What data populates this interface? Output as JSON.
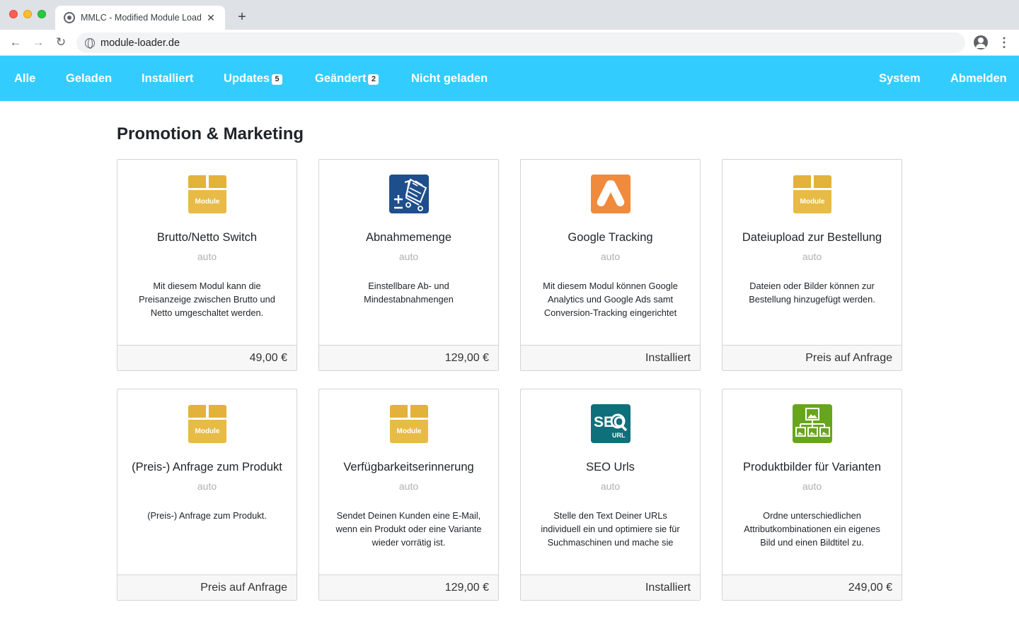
{
  "browser": {
    "tab_title": "MMLC - Modified Module Loader Client",
    "tab_close": "✕",
    "new_tab": "+",
    "url": "module-loader.de"
  },
  "nav": {
    "items": [
      {
        "label": "Alle"
      },
      {
        "label": "Geladen"
      },
      {
        "label": "Installiert"
      },
      {
        "label": "Updates",
        "badge": "5"
      },
      {
        "label": "Geändert",
        "badge": "2"
      },
      {
        "label": "Nicht geladen"
      }
    ],
    "right": [
      {
        "label": "System"
      },
      {
        "label": "Abmelden"
      }
    ],
    "color": "#33ccff"
  },
  "section": {
    "title": "Promotion & Marketing"
  },
  "modules": [
    {
      "icon": "module-box-icon",
      "icon_label": "Module",
      "title": "Brutto/Netto Switch",
      "sub": "auto",
      "desc": "Mit diesem Modul kann die Preisanzeige zwischen Brutto und Netto umgeschaltet werden.",
      "price": "49,00 €"
    },
    {
      "icon": "cart-quantity-icon",
      "title": "Abnahmemenge",
      "sub": "auto",
      "desc": "Einstellbare Ab- und Mindestabnahmengen",
      "price": "129,00 €"
    },
    {
      "icon": "google-ads-icon",
      "title": "Google Tracking",
      "sub": "auto",
      "desc": "Mit diesem Modul können Google Analytics und Google Ads samt Conversion-Tracking eingerichtet",
      "price": "Installiert"
    },
    {
      "icon": "module-box-icon",
      "icon_label": "Module",
      "title": "Dateiupload zur Bestellung",
      "sub": "auto",
      "desc": "Dateien oder Bilder können zur Bestellung hinzugefügt werden.",
      "price": "Preis auf Anfrage"
    },
    {
      "icon": "module-box-icon",
      "icon_label": "Module",
      "title": "(Preis-) Anfrage zum Produkt",
      "sub": "auto",
      "desc": "(Preis-) Anfrage zum Produkt.",
      "price": "Preis auf Anfrage"
    },
    {
      "icon": "module-box-icon",
      "icon_label": "Module",
      "title": "Verfügbarkeitserinnerung",
      "sub": "auto",
      "desc": "Sendet Deinen Kunden eine E-Mail, wenn ein Produkt oder eine Variante wieder vorrätig ist.",
      "price": "129,00 €"
    },
    {
      "icon": "seo-url-icon",
      "icon_label": "SEO",
      "icon_label2": "URL",
      "title": "SEO Urls",
      "sub": "auto",
      "desc": "Stelle den Text Deiner URLs individuell ein und optimiere sie für Suchmaschinen und mache sie",
      "price": "Installiert"
    },
    {
      "icon": "variant-images-icon",
      "title": "Produktbilder für Varianten",
      "sub": "auto",
      "desc": "Ordne unterschiedlichen Attributkombinationen ein eigenes Bild und einen Bildtitel zu.",
      "price": "249,00 €"
    }
  ]
}
